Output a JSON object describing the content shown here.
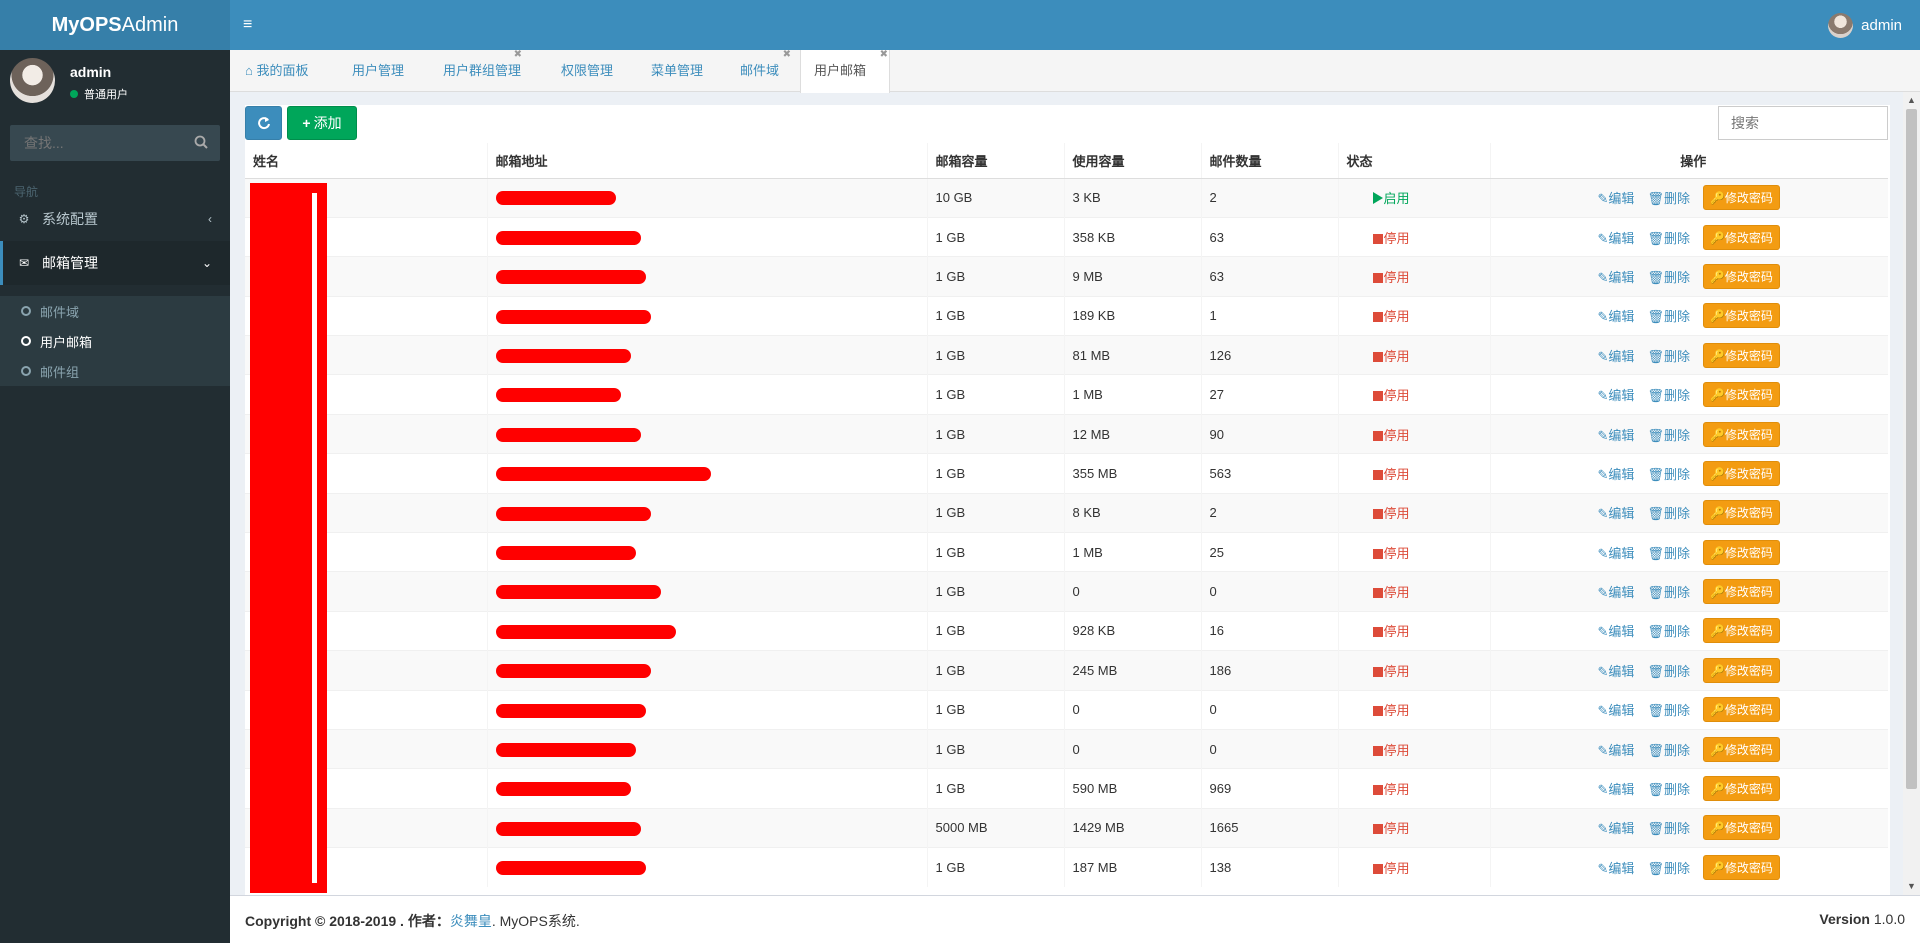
{
  "header": {
    "logo_bold": "MyOPS",
    "logo_rest": "Admin",
    "user": "admin"
  },
  "sidebar": {
    "user_name": "admin",
    "user_role": "普通用户",
    "search_placeholder": "查找...",
    "nav_header": "导航",
    "items": [
      {
        "label": "系统配置",
        "icon": "gears-icon"
      },
      {
        "label": "邮箱管理",
        "icon": "envelope-icon"
      }
    ],
    "subitems": [
      {
        "label": "邮件域"
      },
      {
        "label": "用户邮箱"
      },
      {
        "label": "邮件组"
      }
    ]
  },
  "tabs": [
    {
      "label": "我的面板",
      "icon": "home-icon"
    },
    {
      "label": "用户管理"
    },
    {
      "label": "用户群组管理"
    },
    {
      "label": "权限管理"
    },
    {
      "label": "菜单管理"
    },
    {
      "label": "邮件域"
    },
    {
      "label": "用户邮箱"
    }
  ],
  "toolbar": {
    "add_label": "添加",
    "search_placeholder": "搜索"
  },
  "table": {
    "headers": [
      "姓名",
      "邮箱地址",
      "邮箱容量",
      "使用容量",
      "邮件数量",
      "状态",
      "操作"
    ],
    "rows": [
      {
        "capacity": "10 GB",
        "used": "3 KB",
        "count": "2",
        "status": "启用"
      },
      {
        "capacity": "1 GB",
        "used": "358 KB",
        "count": "63",
        "status": "停用"
      },
      {
        "capacity": "1 GB",
        "used": "9 MB",
        "count": "63",
        "status": "停用"
      },
      {
        "capacity": "1 GB",
        "used": "189 KB",
        "count": "1",
        "status": "停用"
      },
      {
        "capacity": "1 GB",
        "used": "81 MB",
        "count": "126",
        "status": "停用"
      },
      {
        "capacity": "1 GB",
        "used": "1 MB",
        "count": "27",
        "status": "停用"
      },
      {
        "capacity": "1 GB",
        "used": "12 MB",
        "count": "90",
        "status": "停用"
      },
      {
        "capacity": "1 GB",
        "used": "355 MB",
        "count": "563",
        "status": "停用"
      },
      {
        "capacity": "1 GB",
        "used": "8 KB",
        "count": "2",
        "status": "停用"
      },
      {
        "capacity": "1 GB",
        "used": "1 MB",
        "count": "25",
        "status": "停用"
      },
      {
        "capacity": "1 GB",
        "used": "0",
        "count": "0",
        "status": "停用"
      },
      {
        "capacity": "1 GB",
        "used": "928 KB",
        "count": "16",
        "status": "停用"
      },
      {
        "capacity": "1 GB",
        "used": "245 MB",
        "count": "186",
        "status": "停用"
      },
      {
        "capacity": "1 GB",
        "used": "0",
        "count": "0",
        "status": "停用"
      },
      {
        "capacity": "1 GB",
        "used": "0",
        "count": "0",
        "status": "停用"
      },
      {
        "capacity": "1 GB",
        "used": "590 MB",
        "count": "969",
        "status": "停用"
      },
      {
        "capacity": "5000 MB",
        "used": "1429 MB",
        "count": "1665",
        "status": "停用"
      },
      {
        "capacity": "1 GB",
        "used": "187 MB",
        "count": "138",
        "status": "停用"
      }
    ],
    "actions": {
      "edit": "编辑",
      "delete": "删除",
      "change_password": "修改密码"
    }
  },
  "footer": {
    "copyright": "Copyright © 2018-2019 . 作者：",
    "author": "炎舞皇",
    "system": ". MyOPS系统.",
    "version_label": "Version",
    "version": "1.0.0"
  },
  "colors": {
    "header": "#3c8dbc",
    "sidebar": "#222d32",
    "success": "#00a65a",
    "danger": "#dd4b39",
    "warning": "#f39c12",
    "redaction": "#ff0000"
  }
}
